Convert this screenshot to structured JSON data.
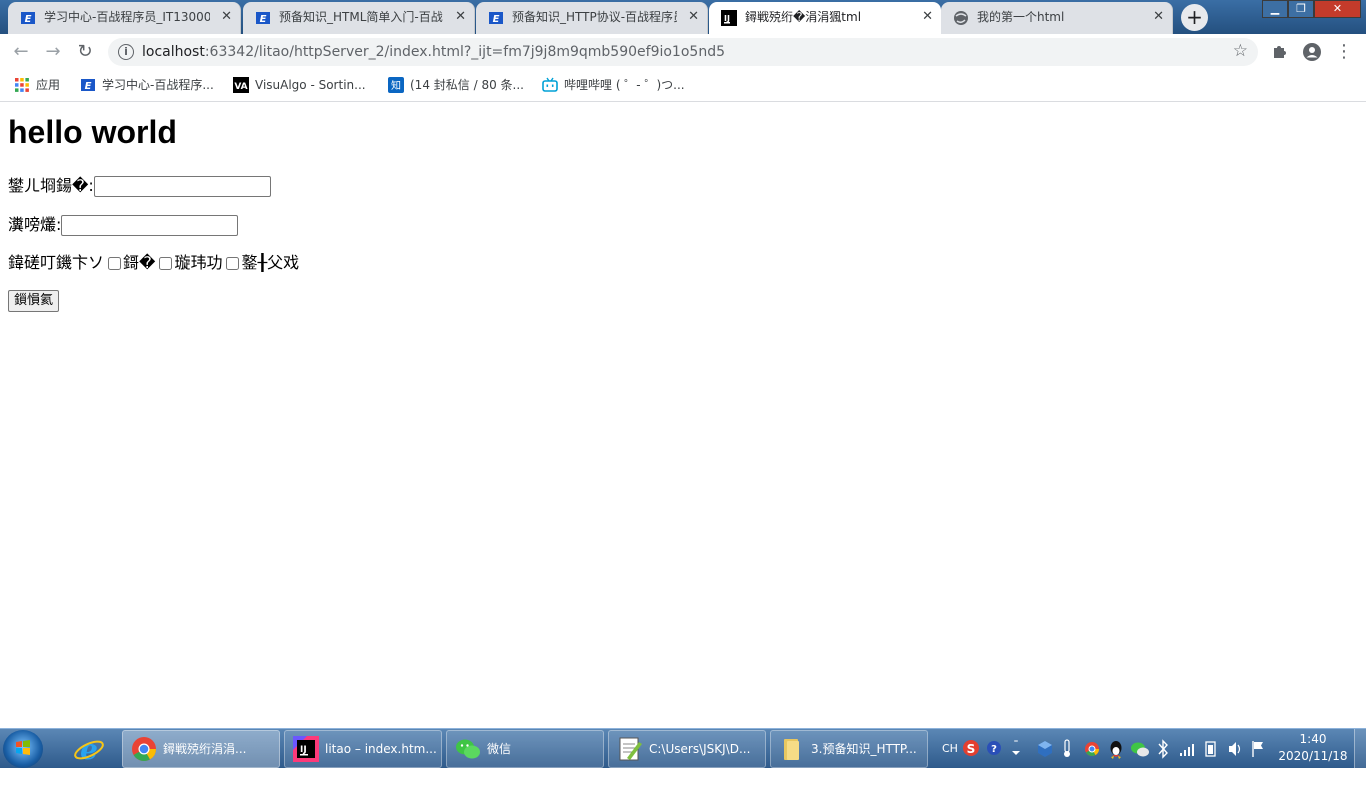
{
  "tabs": [
    {
      "title": "学习中心-百战程序员_IT13000",
      "icon": "baizhan-icon"
    },
    {
      "title": "预备知识_HTML简单入门-百战",
      "icon": "baizhan-icon"
    },
    {
      "title": "预备知识_HTTP协议-百战程序员",
      "icon": "baizhan-icon"
    },
    {
      "title": "鐞戦殑绗�涓涓猦tml",
      "icon": "intellij-icon"
    },
    {
      "title": "我的第一个html",
      "icon": "globe-icon"
    }
  ],
  "new_tab_label": "+",
  "address_bar": {
    "host": "localhost",
    "rest": ":63342/litao/httpServer_2/index.html?_ijt=fm7j9j8m9qmb590ef9io1o5nd5"
  },
  "bookmarks": [
    {
      "label": "应用",
      "icon": "apps-icon"
    },
    {
      "label": "学习中心-百战程序...",
      "icon": "baizhan-icon"
    },
    {
      "label": "VisuAlgo - Sortin...",
      "icon": "visualgo-icon"
    },
    {
      "label": "(14 封私信 / 80 条...",
      "icon": "zhihu-icon"
    },
    {
      "label": "哔哩哔哩 ( ゜- ゜)つ...",
      "icon": "bilibili-icon"
    }
  ],
  "page": {
    "heading": "hello world",
    "username_label": "鐢ㄦ埛鍚�:",
    "password_label": "瀵嗙爜:",
    "hobby_label": "鍏磋叮鐖卞ソ",
    "hobbies": [
      "鎶�",
      "璇玮功",
      "鐜╂父戏"
    ],
    "submit_label": "鎻愪氦"
  },
  "taskbar": {
    "items": [
      {
        "label": "鐞戦殑绗涓涓...",
        "icon": "chrome-icon"
      },
      {
        "label": "litao – index.htm...",
        "icon": "intellij-icon"
      },
      {
        "label": "微信",
        "icon": "wechat-icon"
      },
      {
        "label": "C:\\Users\\JSKJ\\D...",
        "icon": "notepadpp-icon"
      },
      {
        "label": "3.预备知识_HTTP...",
        "icon": "folder-icon"
      }
    ],
    "ime": "CH",
    "time": "1:40",
    "date": "2020/11/18"
  }
}
